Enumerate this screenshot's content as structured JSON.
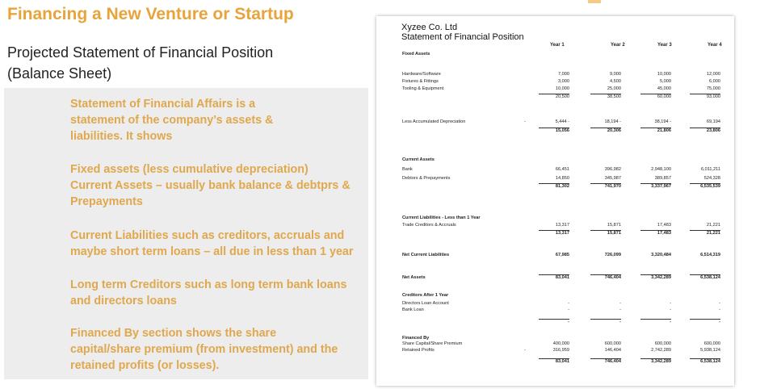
{
  "slide": {
    "title": "Financing a New Venture or Startup",
    "subtitle_line1": "Projected Statement of Financial Position",
    "subtitle_line2": "(Balance Sheet)",
    "bullets": [
      {
        "lines": [
          "Statement of Financial Affairs is a",
          "statement of the company’s assets &",
          "liabilities. It shows"
        ]
      },
      {
        "lines": [
          "Fixed assets (less cumulative depreciation)",
          "Current Assets – usually bank balance & debtprs &",
          "Prepayments"
        ]
      },
      {
        "lines": [
          "Current Liabilities such as creditors, accruals and",
          "maybe short term loans – all due in less than 1 year"
        ]
      },
      {
        "lines": [
          "Long term Creditors such as long term bank loans",
          "and directors loans"
        ]
      },
      {
        "lines": [
          "Financed By section shows the share",
          "capital/share premium (from investment) and the",
          "retained profits (or losses)."
        ]
      }
    ]
  },
  "sheet": {
    "company": "Xyzee Co. Ltd",
    "statement": "Statement of Financial Position",
    "years": [
      "Year 1",
      "Year 2",
      "Year 3",
      "Year 4"
    ],
    "rows": [
      {
        "label": "Fixed Assets",
        "bold": true,
        "values": []
      },
      {
        "label": "Hardware/Software",
        "values": [
          "7,000",
          "9,000",
          "10,000",
          "12,000"
        ]
      },
      {
        "label": "Fixtures & Fittings",
        "values": [
          "3,000",
          "4,500",
          "5,000",
          "6,000"
        ]
      },
      {
        "label": "Tooling & Equipment",
        "values": [
          "10,000",
          "25,000",
          "45,000",
          "75,000"
        ]
      },
      {
        "label": "",
        "values": [
          "20,500",
          "38,500",
          "60,000",
          "93,000"
        ]
      },
      {
        "label": "Less Accumulated Depreciation",
        "neg": "-",
        "values": [
          "5,444 -",
          "18,194 -",
          "38,194 -",
          "69,194"
        ]
      },
      {
        "label": "",
        "bold": true,
        "values": [
          "15,056",
          "20,306",
          "21,806",
          "23,806"
        ]
      },
      {
        "label": "Current Assets",
        "bold": true,
        "values": []
      },
      {
        "label": "Bank",
        "values": [
          "66,451",
          "396,982",
          "2,948,100",
          "6,011,211"
        ]
      },
      {
        "label": "Debtors & Prepayments",
        "values": [
          "14,850",
          "345,987",
          "389,857",
          "524,328"
        ]
      },
      {
        "label": "",
        "bold": true,
        "values": [
          "81,302",
          "741,970",
          "3,337,967",
          "6,535,539"
        ]
      },
      {
        "label": "Current Liabilities - Less than 1 Year",
        "bold": true,
        "values": []
      },
      {
        "label": "Trade Creditors & Accruals",
        "values": [
          "13,317",
          "15,871",
          "17,483",
          "21,221"
        ]
      },
      {
        "label": "",
        "bold": true,
        "values": [
          "13,317",
          "15,871",
          "17,483",
          "21,221"
        ]
      },
      {
        "label": "Net Current Liabilities",
        "bold": true,
        "values": [
          "67,985",
          "726,099",
          "3,320,484",
          "6,514,319"
        ]
      },
      {
        "label": "Net Assets",
        "bold": true,
        "values": [
          "83,041",
          "746,404",
          "3,342,289",
          "6,538,124"
        ]
      },
      {
        "label": "Creditors After 1 Year",
        "bold": true,
        "values": []
      },
      {
        "label": "Directors Loan Account",
        "values": [
          "-",
          "-",
          "-",
          "-"
        ]
      },
      {
        "label": "Bank Loan",
        "values": [
          "-",
          "-",
          "-",
          "-"
        ]
      },
      {
        "label": "",
        "bold": true,
        "values": [
          "-",
          "-",
          "-",
          "-"
        ]
      },
      {
        "label": "Financed By",
        "bold": true,
        "values": []
      },
      {
        "label": "Share Capital/Share Premium",
        "values": [
          "400,000",
          "600,000",
          "600,000",
          "600,000"
        ]
      },
      {
        "label": "Retained Profits",
        "neg": "-",
        "values": [
          "316,959",
          "146,404",
          "2,742,289",
          "5,938,124"
        ]
      },
      {
        "label": "",
        "bold": true,
        "values": [
          "83,041",
          "746,404",
          "3,342,289",
          "6,538,124"
        ]
      }
    ]
  }
}
